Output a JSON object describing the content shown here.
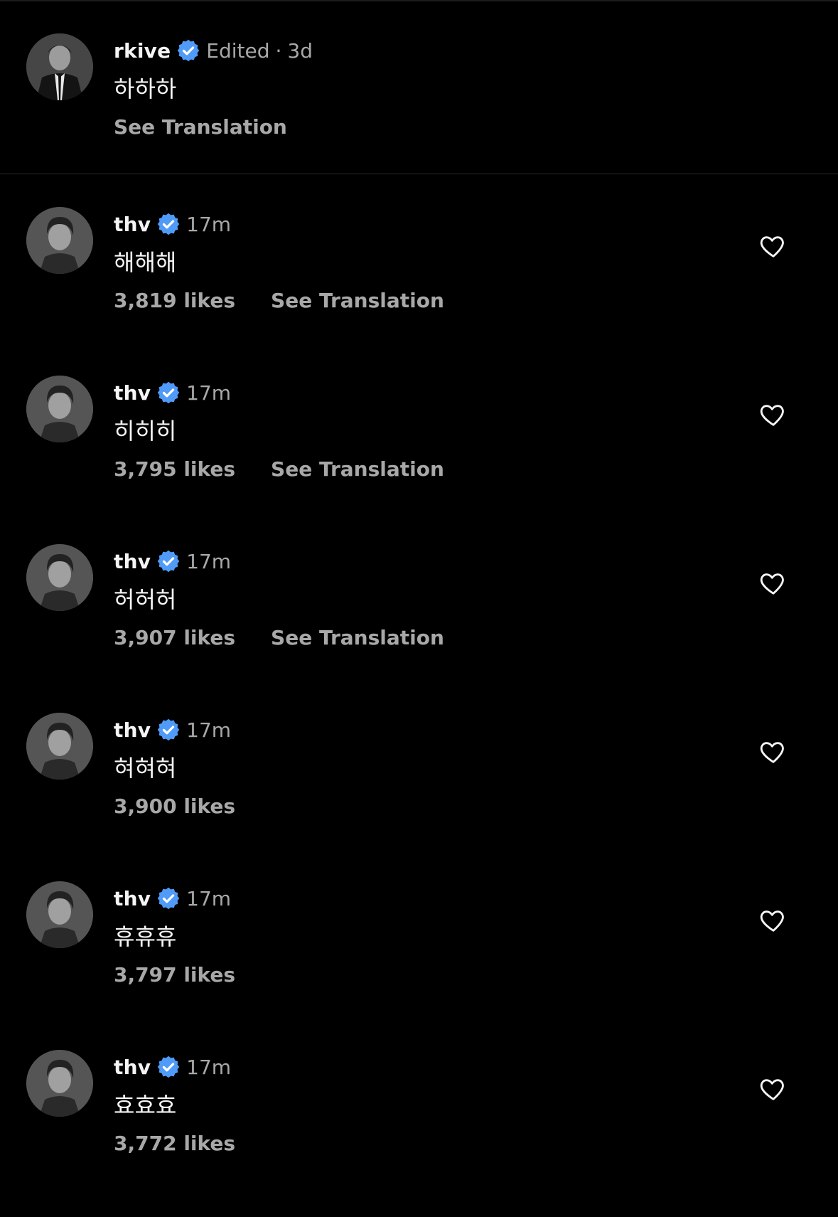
{
  "caption": {
    "username": "rkive",
    "edited_label": "Edited",
    "separator": "·",
    "time": "3d",
    "text": "하하하",
    "see_translation": "See Translation"
  },
  "comments": [
    {
      "username": "thv",
      "time": "17m",
      "text": "해해해",
      "likes": "3,819 likes",
      "see_translation": "See Translation"
    },
    {
      "username": "thv",
      "time": "17m",
      "text": "히히히",
      "likes": "3,795 likes",
      "see_translation": "See Translation"
    },
    {
      "username": "thv",
      "time": "17m",
      "text": "허허허",
      "likes": "3,907 likes",
      "see_translation": "See Translation"
    },
    {
      "username": "thv",
      "time": "17m",
      "text": "혀혀혀",
      "likes": "3,900 likes"
    },
    {
      "username": "thv",
      "time": "17m",
      "text": "휴휴휴",
      "likes": "3,797 likes"
    },
    {
      "username": "thv",
      "time": "17m",
      "text": "효효효",
      "likes": "3,772 likes"
    }
  ],
  "icons": {
    "verified": "verified-badge-icon",
    "like": "heart-icon"
  },
  "colors": {
    "background": "#000000",
    "primary_text": "#f5f5f5",
    "secondary_text": "#a8a8a8",
    "verified_blue": "#4f9bf7",
    "divider": "#262626"
  }
}
